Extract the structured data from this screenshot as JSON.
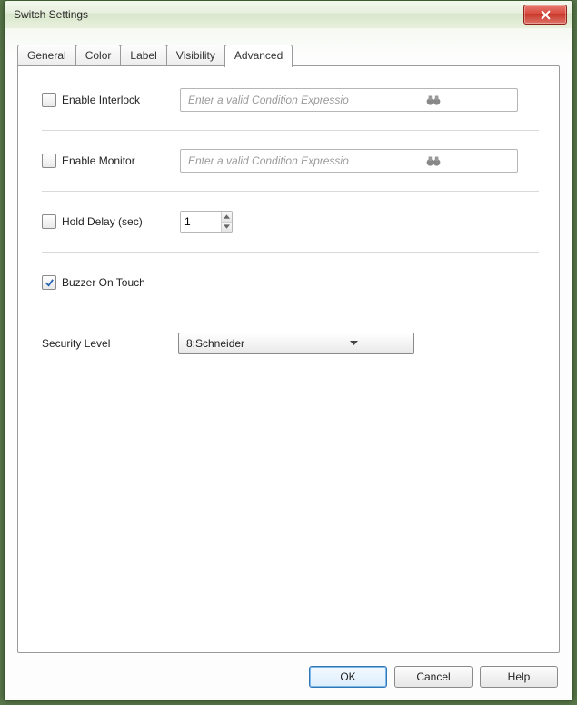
{
  "window": {
    "title": "Switch Settings"
  },
  "tabs": {
    "items": [
      "General",
      "Color",
      "Label",
      "Visibility",
      "Advanced"
    ],
    "active": 4
  },
  "advanced": {
    "interlock": {
      "label": "Enable Interlock",
      "checked": false,
      "placeholder": "Enter a valid Condition Expression. Its data type must b"
    },
    "monitor": {
      "label": "Enable Monitor",
      "checked": false,
      "placeholder": "Enter a valid Condition Expression. Its data type must b"
    },
    "hold_delay": {
      "label": "Hold Delay (sec)",
      "checked": false,
      "value": "1"
    },
    "buzzer": {
      "label": "Buzzer On Touch",
      "checked": true
    },
    "security": {
      "label": "Security Level",
      "value": "8:Schneider"
    }
  },
  "buttons": {
    "ok": "OK",
    "cancel": "Cancel",
    "help": "Help"
  }
}
